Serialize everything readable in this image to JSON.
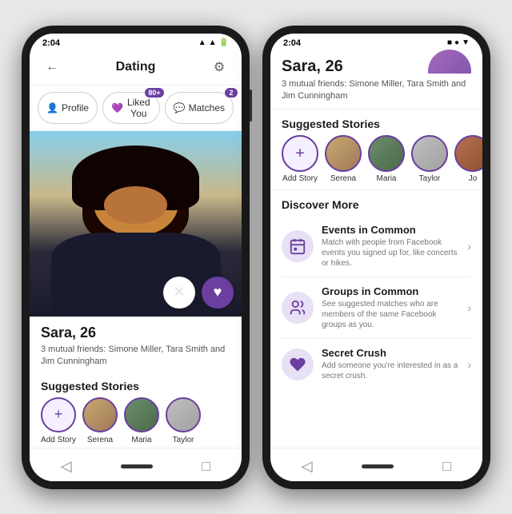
{
  "background_color": "#e8e8e8",
  "phone1": {
    "status_time": "2:04",
    "header": {
      "title": "Dating",
      "back_label": "←",
      "settings_label": "⚙"
    },
    "tabs": [
      {
        "id": "profile",
        "label": "Profile",
        "icon": "👤",
        "badge": null
      },
      {
        "id": "liked_you",
        "label": "Liked You",
        "icon": "💜",
        "badge": "80+"
      },
      {
        "id": "matches",
        "label": "Matches",
        "icon": "💬",
        "badge": "2"
      }
    ],
    "profile": {
      "name": "Sara, 26",
      "friends_text": "3 mutual friends: Simone Miller, Tara Smith and Jim Cunningham",
      "action_x": "✕",
      "action_heart": "♥"
    },
    "suggested_stories": {
      "title": "Suggested Stories",
      "items": [
        {
          "id": "add",
          "label": "Add Story",
          "icon": "+",
          "type": "add"
        },
        {
          "id": "serena",
          "label": "Serena",
          "type": "person"
        },
        {
          "id": "maria",
          "label": "Maria",
          "type": "person"
        },
        {
          "id": "taylor",
          "label": "Taylor",
          "type": "person"
        }
      ]
    },
    "nav": {
      "back": "◁",
      "home": "",
      "square": "□"
    }
  },
  "phone2": {
    "status_time": "2:04",
    "profile": {
      "name": "Sara, 26",
      "friends_text": "3 mutual friends: Simone Miller, Tara Smith and Jim Cunningham"
    },
    "suggested_stories": {
      "title": "Suggested Stories",
      "items": [
        {
          "id": "add",
          "label": "Add Story",
          "icon": "+",
          "type": "add"
        },
        {
          "id": "serena",
          "label": "Serena",
          "type": "person"
        },
        {
          "id": "maria",
          "label": "Maria",
          "type": "person"
        },
        {
          "id": "taylor",
          "label": "Taylor",
          "type": "person"
        },
        {
          "id": "jo",
          "label": "Jo",
          "type": "person"
        }
      ]
    },
    "discover": {
      "title": "Discover More",
      "items": [
        {
          "id": "events",
          "icon": "📅",
          "title": "Events in Common",
          "description": "Match with people from Facebook events you signed up for, like concerts or hikes."
        },
        {
          "id": "groups",
          "icon": "👥",
          "title": "Groups in Common",
          "description": "See suggested matches who are members of the same Facebook groups as you."
        },
        {
          "id": "secret_crush",
          "icon": "💜",
          "title": "Secret Crush",
          "description": "Add someone you're interested in as a secret crush."
        }
      ]
    },
    "nav": {
      "back": "◁",
      "home": "",
      "square": "□"
    }
  }
}
